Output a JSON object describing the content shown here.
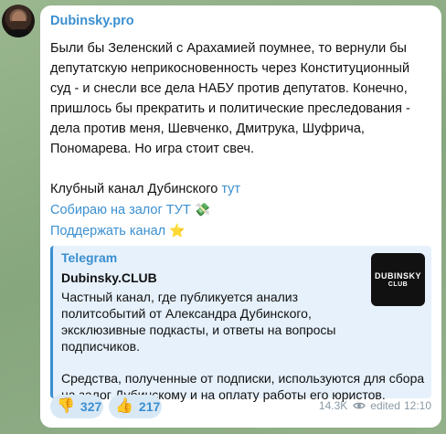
{
  "channel": {
    "name": "Dubinsky.pro"
  },
  "post": {
    "text": "Были бы Зеленский с Арахамией поумнее, то вернули бы депутатскую неприкосновенность через Конституционный суд - и снесли все дела НАБУ против депутатов. Конечно, пришлось бы прекратить и политические преследования - дела против меня, Шевченко, Дмитрука, Шуфрича, Пономарева. Но игра стоит свеч.",
    "club_line_text": "Клубный канал Дубинского ",
    "club_link": "тут",
    "collect_link": "Собираю на залог ТУТ",
    "collect_emoji": "💸",
    "support_link": "Поддержать канал",
    "support_emoji": "⭐"
  },
  "preview": {
    "site": "Telegram",
    "title": "Dubinsky.CLUB",
    "description": "Частный канал, где публикуется анализ политсобытий от Александра Дубинского, эксклюзивные подкасты, и ответы на вопросы подписчиков.",
    "note": "Средства, полученные от подписки, используются для сбора на залог Дубинскому и на оплату работы его юристов.",
    "thumb_line1": "DUBINSKY",
    "thumb_line2": "CLUB"
  },
  "reactions": [
    {
      "emoji": "👎",
      "count": "327"
    },
    {
      "emoji": "👍",
      "count": "217"
    }
  ],
  "meta": {
    "views": "14.3K",
    "edited": "edited",
    "time": "12:10"
  },
  "colors": {
    "accent": "#3a8fd0",
    "reaction_bg": "#d9e8f5",
    "preview_bg": "#e6f1fb"
  }
}
